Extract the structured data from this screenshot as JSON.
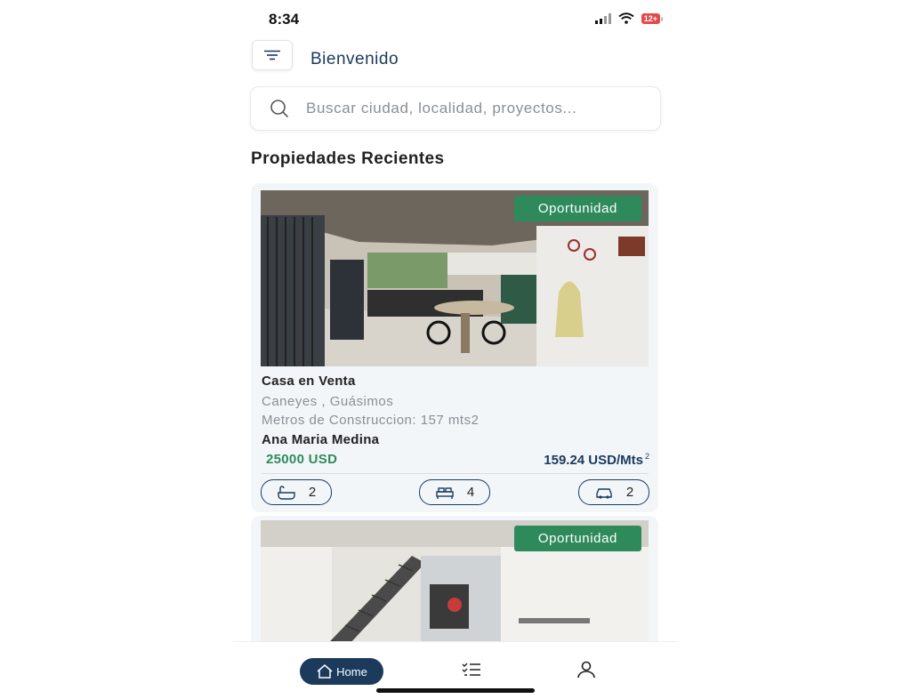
{
  "status": {
    "time": "8:34",
    "battery": "12+"
  },
  "header": {
    "greeting": "Bienvenido"
  },
  "search": {
    "placeholder": "Buscar ciudad, localidad, proyectos..."
  },
  "section": {
    "title": "Propiedades Recientes"
  },
  "cards": [
    {
      "badge": "Oportunidad",
      "title": "Casa en Venta",
      "location": "Caneyes , Guásimos",
      "meters": "Metros de Construccion: 157 mts2",
      "agent": "Ana Maria Medina",
      "price": "25000 USD",
      "price_per_meter": "159.24 USD/Mts",
      "price_per_meter_sup": "2",
      "baths": "2",
      "beds": "4",
      "parking": "2"
    },
    {
      "badge": "Oportunidad"
    }
  ],
  "nav": {
    "home_label": "Home"
  },
  "colors": {
    "primary": "#1b3a5c",
    "accent_green": "#2f8a5b",
    "card_bg": "#f3f6f9"
  }
}
